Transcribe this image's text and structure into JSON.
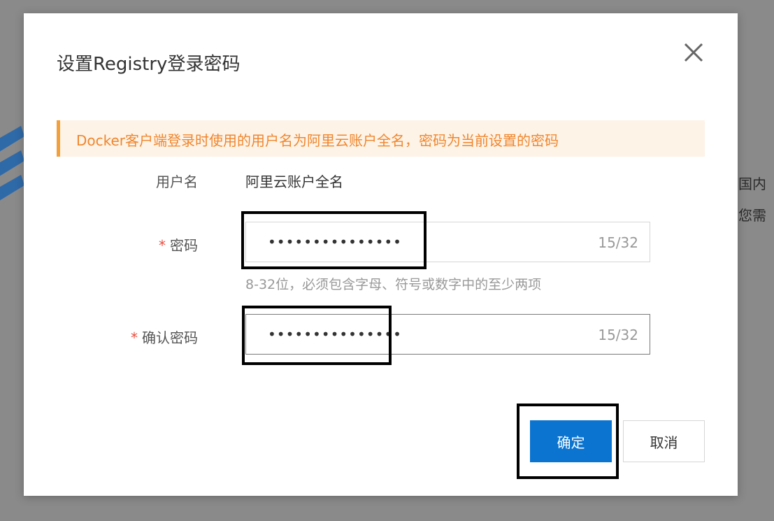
{
  "background": {
    "text_line1": "国内",
    "text_line2": "您需"
  },
  "dialog": {
    "title": "设置Registry登录密码",
    "close_icon": "close-icon",
    "notice": "Docker客户端登录时使用的用户名为阿里云账户全名，密码为当前设置的密码",
    "username": {
      "label": "用户名",
      "value": "阿里云账户全名"
    },
    "password": {
      "required_mark": "*",
      "label": "密码",
      "value": "•••••••••••••••",
      "counter": "15/32",
      "hint": "8-32位，必须包含字母、符号或数字中的至少两项"
    },
    "confirm_password": {
      "required_mark": "*",
      "label": "确认密码",
      "value": "•••••••••••••••",
      "counter": "15/32"
    },
    "buttons": {
      "confirm": "确定",
      "cancel": "取消"
    }
  },
  "colors": {
    "primary": "#0a74d0",
    "notice_text": "#f0862d",
    "notice_bg": "#fdf3e7",
    "required": "#e84e40"
  }
}
